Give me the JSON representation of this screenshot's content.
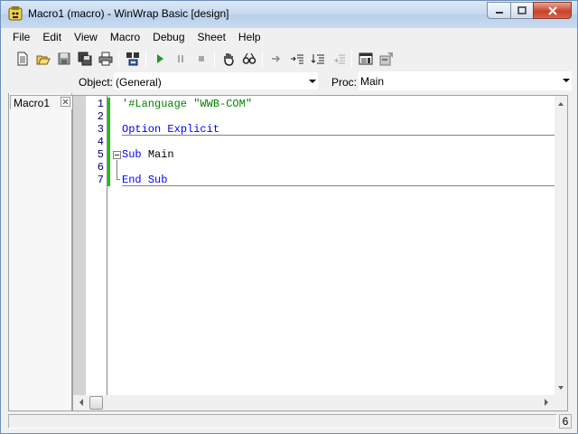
{
  "window": {
    "title": "Macro1 (macro) - WinWrap Basic [design]",
    "accent": "#c6d9f0",
    "close_color": "#c9432a"
  },
  "menu": {
    "items": [
      "File",
      "Edit",
      "View",
      "Macro",
      "Debug",
      "Sheet",
      "Help"
    ]
  },
  "toolbar": {
    "icons": [
      "new-icon",
      "open-icon",
      "save-icon",
      "save-all-icon",
      "print-icon",
      "references-icon",
      "run-icon",
      "pause-icon",
      "stop-icon",
      "hand-icon",
      "quick-watch-icon",
      "step-into-icon",
      "step-over-icon",
      "step-out-icon",
      "step-to-cursor-icon",
      "dialog-editor-icon",
      "properties-icon"
    ]
  },
  "object_row": {
    "object_label": "Object:",
    "object_value": "(General)",
    "proc_label": "Proc:",
    "proc_value": "Main"
  },
  "tabs": [
    {
      "label": "Macro1"
    }
  ],
  "editor": {
    "line_numbers": [
      "1",
      "2",
      "3",
      "4",
      "5",
      "6",
      "7"
    ],
    "lines": [
      {
        "comment": "'#Language \"WWB-COM\""
      },
      {
        "text": ""
      },
      {
        "kw1": "Option",
        "kw2": "Explicit"
      },
      {
        "text": ""
      },
      {
        "kw1": "Sub",
        "name": "Main"
      },
      {
        "text": ""
      },
      {
        "kw1": "End",
        "kw2": "Sub"
      }
    ],
    "change_bar_color": "#19c219",
    "keyword_color": "#0000ff",
    "comment_color": "#008000"
  },
  "status": {
    "message": "",
    "right_value": "6"
  }
}
